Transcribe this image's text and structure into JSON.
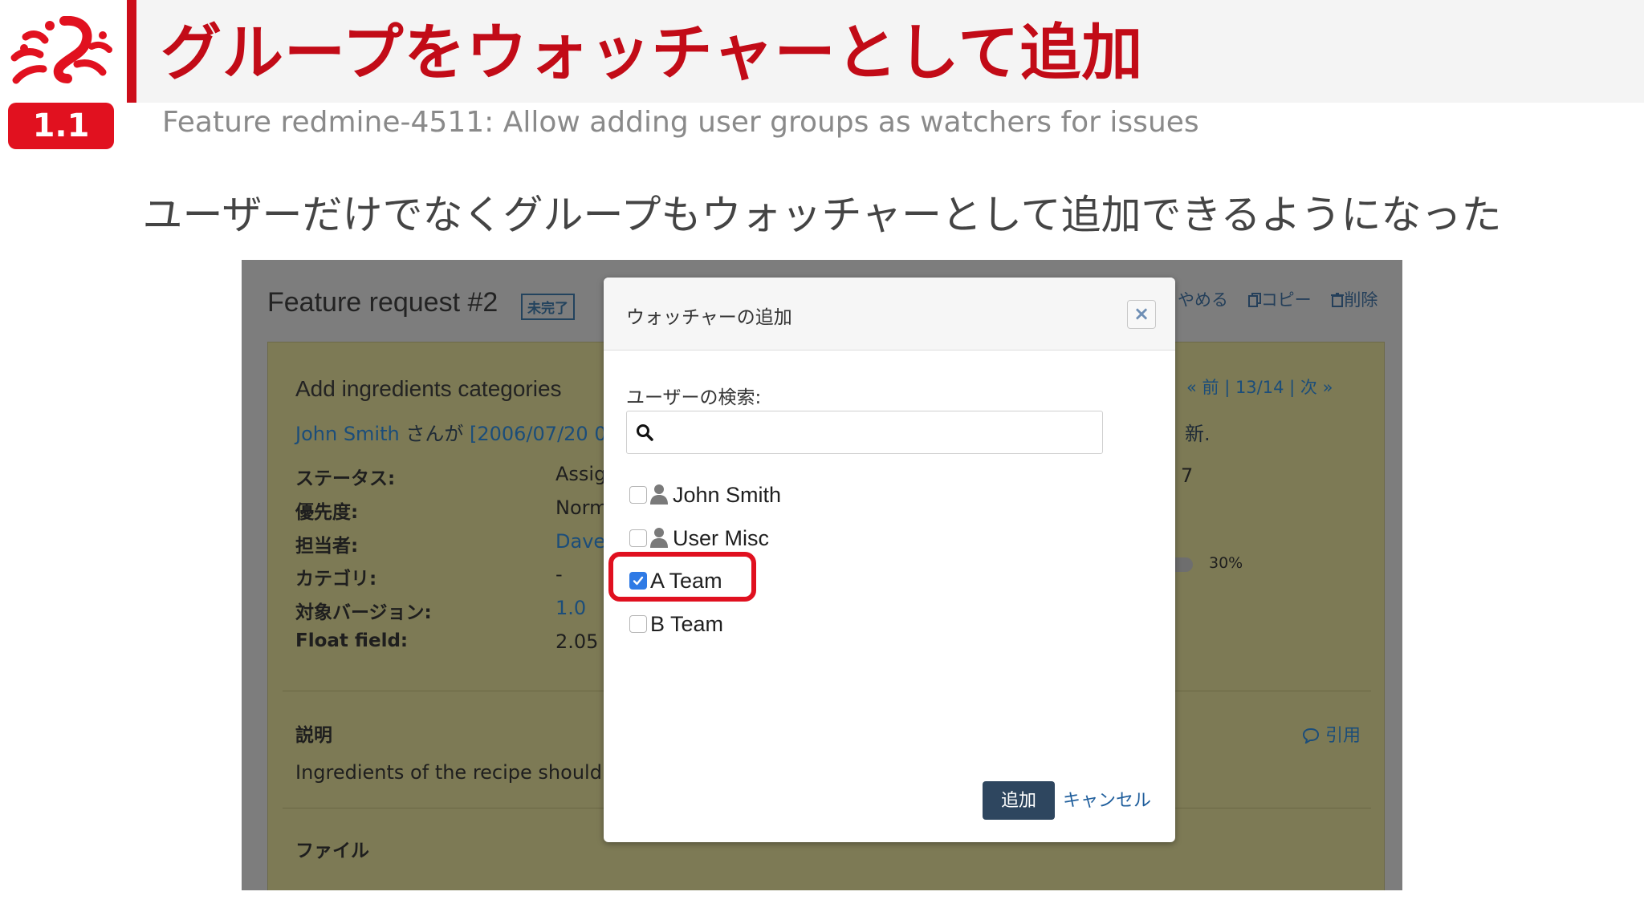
{
  "slide": {
    "version_badge": "1.1",
    "title": "グループをウォッチャーとして追加",
    "subtitle": "Feature redmine-4511: Allow adding user groups as watchers for issues",
    "lead": "ユーザーだけでなくグループもウォッチャーとして追加できるようになった"
  },
  "colors": {
    "brand_red": "#cc0d1a",
    "link_blue": "#1b4d7a",
    "primary_button": "#2e465f",
    "checkbox_checked": "#2f7ae5"
  },
  "issue_page": {
    "title": "Feature request #2",
    "status_tag": "未完了",
    "context_menu": [
      "やめる",
      "コピー",
      "削除"
    ],
    "subject": "Add ingredients categories",
    "author_link": "John Smith",
    "author_suffix": "さんが",
    "date_link": "[2006/07/20 0",
    "pager": "« 前 | 13/14 | 次 »",
    "updated_tail": "新.",
    "attributes": [
      {
        "label": "ステータス:",
        "value": "Assig",
        "link": false
      },
      {
        "label": "優先度:",
        "value": "Norm",
        "link": false
      },
      {
        "label": "担当者:",
        "value": "Dave",
        "link": true
      },
      {
        "label": "カテゴリ:",
        "value": "-",
        "link": false
      },
      {
        "label": "対象バージョン:",
        "value": "1.0",
        "link": true
      },
      {
        "label": "Float field:",
        "value": "2.05",
        "link": false
      }
    ],
    "side_value_top": "7",
    "done_ratio": "30%",
    "description_label": "説明",
    "quote_link": "引用",
    "description_text": "Ingredients of the recipe should b",
    "files_label": "ファイル"
  },
  "modal": {
    "title": "ウォッチャーの追加",
    "close_label": "×",
    "search_label": "ユーザーの検索:",
    "search_value": "",
    "options": [
      {
        "label": "John Smith",
        "type": "user",
        "checked": false
      },
      {
        "label": "User Misc",
        "type": "user",
        "checked": false
      },
      {
        "label": "A Team",
        "type": "group",
        "checked": true
      },
      {
        "label": "B Team",
        "type": "group",
        "checked": false
      }
    ],
    "submit_label": "追加",
    "cancel_label": "キャンセル"
  }
}
